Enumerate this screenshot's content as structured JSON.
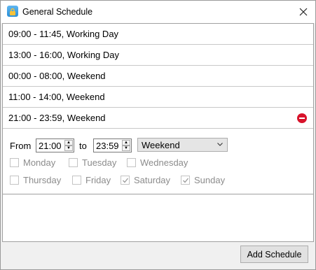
{
  "window": {
    "title": "General Schedule"
  },
  "schedules": [
    {
      "label": "09:00 - 11:45, Working Day"
    },
    {
      "label": "13:00 - 16:00, Working Day"
    },
    {
      "label": "00:00 - 08:00, Weekend"
    },
    {
      "label": "11:00 - 14:00, Weekend"
    },
    {
      "label": "21:00 - 23:59, Weekend"
    }
  ],
  "editor": {
    "from_label": "From",
    "from_value": "21:00",
    "to_label": "to",
    "to_value": "23:59",
    "type_value": "Weekend",
    "days": [
      {
        "label": "Monday",
        "checked": false
      },
      {
        "label": "Tuesday",
        "checked": false
      },
      {
        "label": "Wednesday",
        "checked": false
      },
      {
        "label": "Thursday",
        "checked": false
      },
      {
        "label": "Friday",
        "checked": false
      },
      {
        "label": "Saturday",
        "checked": true
      },
      {
        "label": "Sunday",
        "checked": true
      }
    ]
  },
  "footer": {
    "add_label": "Add Schedule"
  },
  "colors": {
    "remove": "#d8132b",
    "disabled_text": "#8c8c8c"
  }
}
